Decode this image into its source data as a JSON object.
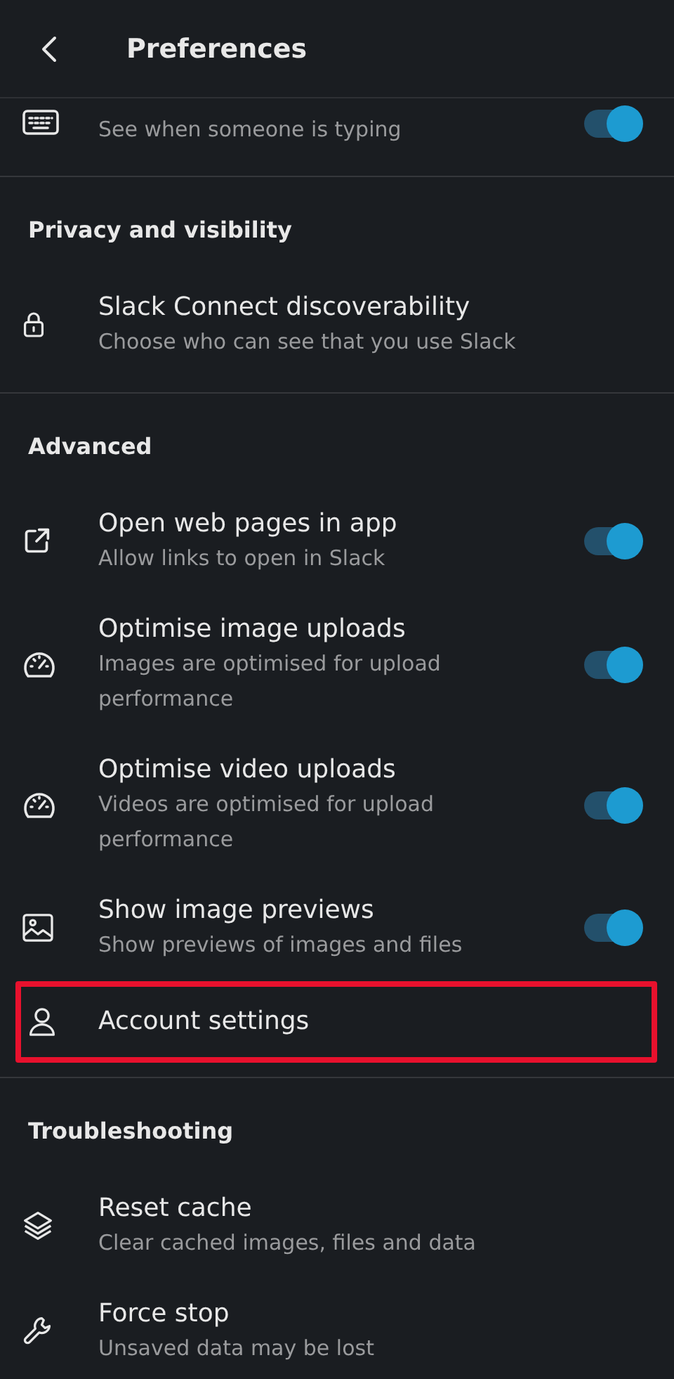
{
  "header": {
    "title": "Preferences"
  },
  "sections": [
    {
      "items": [
        {
          "kind": "toggle",
          "subtitle": "See when someone is typing",
          "on": true
        }
      ]
    },
    {
      "title": "Privacy and visibility",
      "items": [
        {
          "kind": "link",
          "title": "Slack Connect discoverability",
          "subtitle": "Choose who can see that you use Slack"
        }
      ]
    },
    {
      "title": "Advanced",
      "items": [
        {
          "kind": "toggle",
          "title": "Open web pages in app",
          "subtitle": "Allow links to open in Slack",
          "on": true
        },
        {
          "kind": "toggle",
          "title": "Optimise image uploads",
          "subtitle": "Images are optimised for upload performance",
          "on": true
        },
        {
          "kind": "toggle",
          "title": "Optimise video uploads",
          "subtitle": "Videos are optimised for upload performance",
          "on": true
        },
        {
          "kind": "toggle",
          "title": "Show image previews",
          "subtitle": "Show previews of images and files",
          "on": true
        },
        {
          "kind": "link",
          "title": "Account settings",
          "highlighted": true
        }
      ]
    },
    {
      "title": "Troubleshooting",
      "items": [
        {
          "kind": "link",
          "title": "Reset cache",
          "subtitle": "Clear cached images, files and data"
        },
        {
          "kind": "link",
          "title": "Force stop",
          "subtitle": "Unsaved data may be lost"
        }
      ]
    }
  ]
}
